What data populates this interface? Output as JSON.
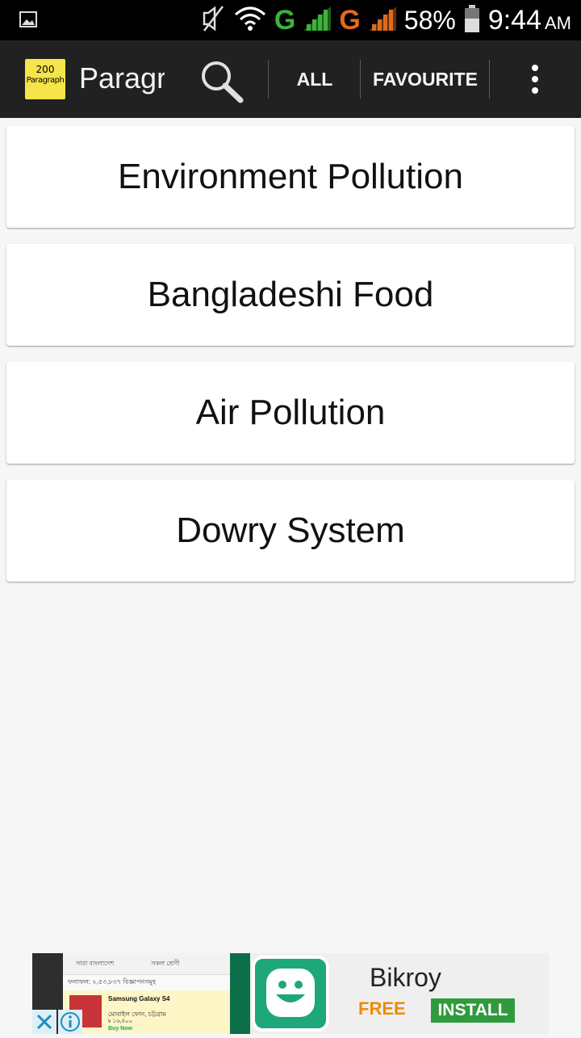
{
  "status_bar": {
    "network_1": "G",
    "network_2": "G",
    "battery": "58%",
    "time": "9:44",
    "ampm": "AM",
    "icons": [
      "image-icon",
      "mute-icon",
      "wifi-icon",
      "signal-icon",
      "signal-icon",
      "battery-icon"
    ]
  },
  "app_bar": {
    "logo_line1": "200",
    "logo_line2": "Paragraph",
    "title": "Paragraph",
    "tab_all": "ALL",
    "tab_favourite": "FAVOURITE",
    "icons": [
      "search-icon",
      "overflow-menu-icon"
    ]
  },
  "items": [
    {
      "label": "Environment Pollution"
    },
    {
      "label": "Bangladeshi Food"
    },
    {
      "label": "Air Pollution"
    },
    {
      "label": "Dowry System"
    }
  ],
  "ad": {
    "app_name": "Bikroy",
    "price": "FREE",
    "install_label": "INSTALL",
    "preview_location": "সারা বাংলাদেশ",
    "preview_category": "সকল শ্রেণী",
    "preview_results": "ফলাফল: ২,৫৩,৮৩৭ বিজ্ঞাপনসমূহ",
    "preview_product": "Samsung Galaxy S4",
    "preview_subtitle": "মোবাইল ফোন, চট্টগ্রাম",
    "preview_price": "৳ ১৬,৪০০",
    "preview_buy": "Buy Now",
    "accent": "#1ea77a",
    "free_color": "#f08a00",
    "install_color": "#2f9a3e"
  }
}
